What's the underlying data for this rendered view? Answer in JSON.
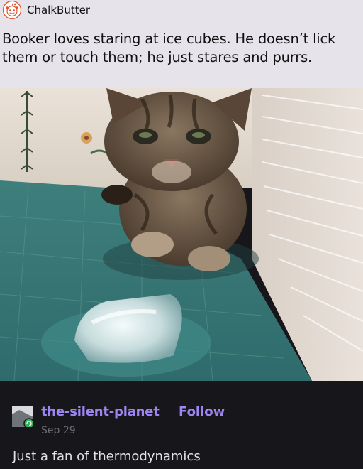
{
  "post": {
    "username": "ChalkButter",
    "text": "Booker loves staring at ice cubes. He doesn’t lick them or touch them; he just stares and purrs.",
    "avatar_icon": "reddit-snoo-icon"
  },
  "photo": {
    "subject_icon": "kitten-photo"
  },
  "reblog": {
    "blog_name": "the-silent-planet",
    "follow_label": "Follow",
    "date": "Sep 29",
    "bio": "Just a fan of thermodynamics",
    "accent_color": "#9c86f2",
    "badge_color": "#32b35c"
  }
}
